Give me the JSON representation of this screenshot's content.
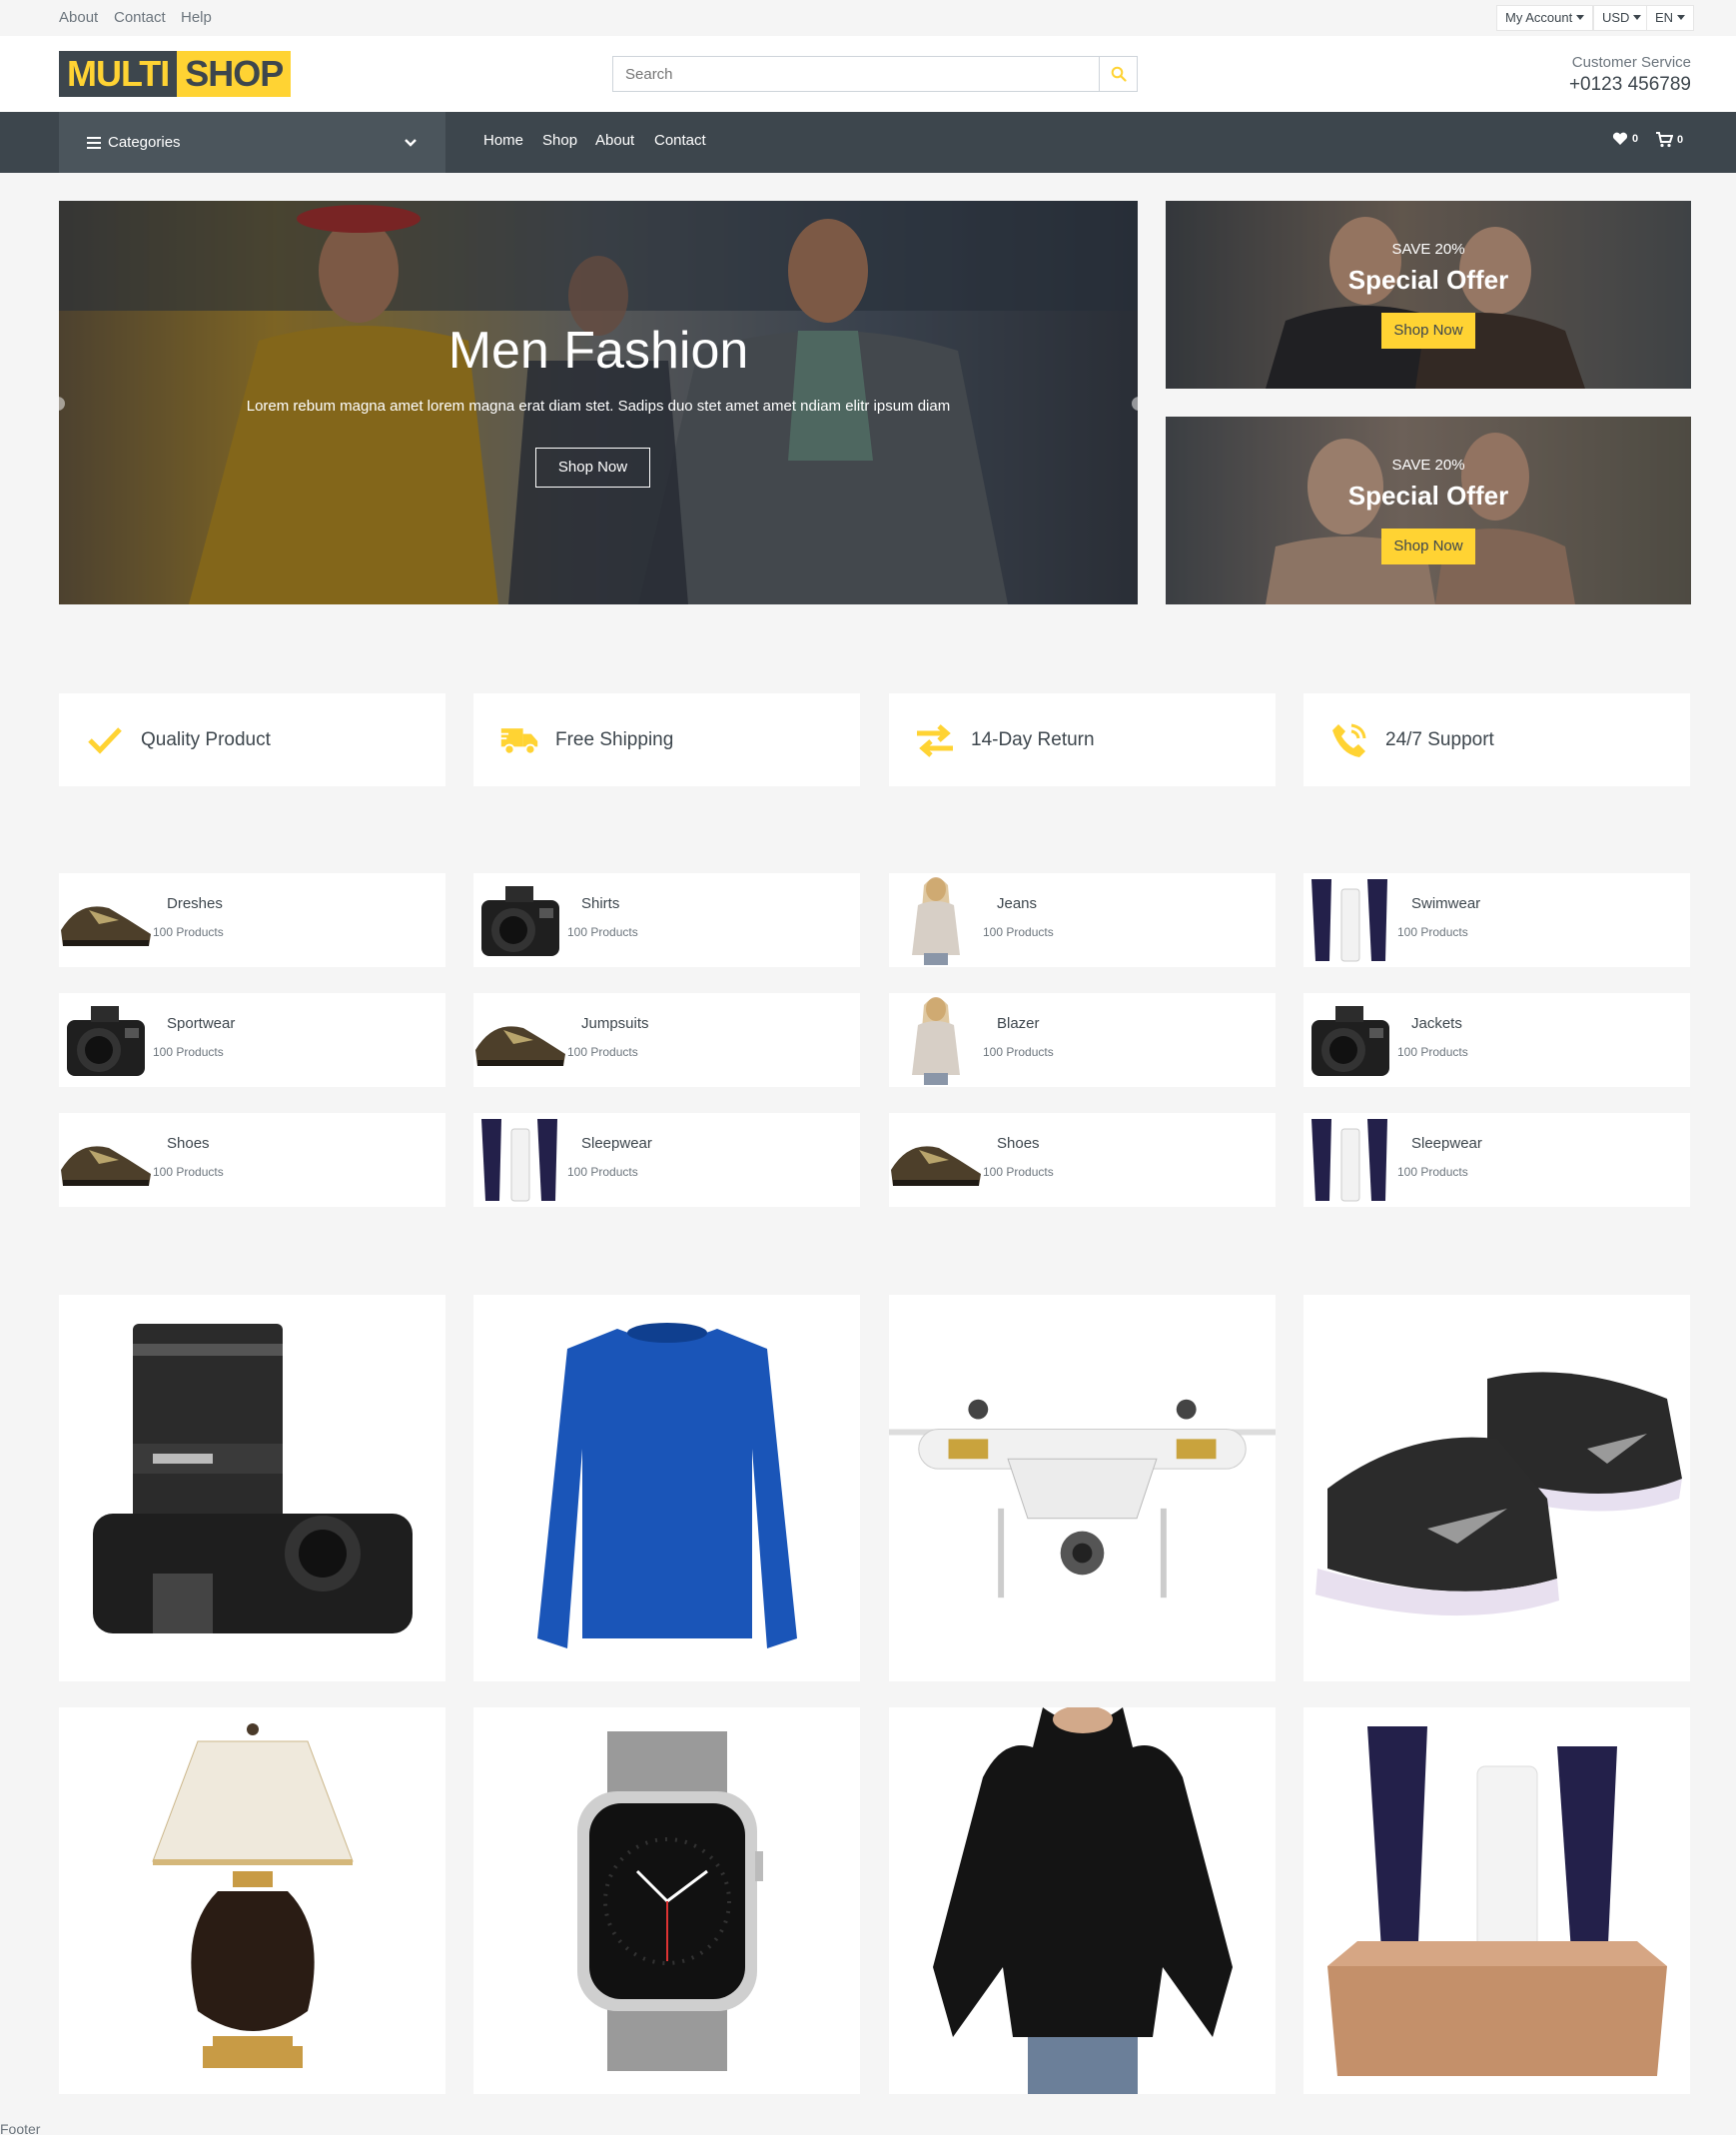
{
  "topbar": {
    "links": [
      "About",
      "Contact",
      "Help"
    ],
    "account_label": "My Account",
    "currency_label": "USD",
    "language_label": "EN"
  },
  "header": {
    "logo_part1": "MULTI",
    "logo_part2": "SHOP",
    "search_placeholder": "Search",
    "service_label": "Customer Service",
    "service_phone": "+0123 456789"
  },
  "navbar": {
    "categories_label": "Categories",
    "links": [
      "Home",
      "Shop",
      "About",
      "Contact"
    ],
    "wishlist_count": "0",
    "cart_count": "0"
  },
  "hero": {
    "title": "Men Fashion",
    "text": "Lorem rebum magna amet lorem magna erat diam stet. Sadips duo stet amet amet ndiam elitr ipsum diam",
    "button_label": "Shop Now"
  },
  "offers": [
    {
      "save": "SAVE 20%",
      "title": "Special Offer",
      "button_label": "Shop Now"
    },
    {
      "save": "SAVE 20%",
      "title": "Special Offer",
      "button_label": "Shop Now"
    }
  ],
  "features": [
    {
      "label": "Quality Product",
      "icon": "check-icon"
    },
    {
      "label": "Free Shipping",
      "icon": "shipping-icon"
    },
    {
      "label": "14-Day Return",
      "icon": "exchange-icon"
    },
    {
      "label": "24/7 Support",
      "icon": "phone-icon"
    }
  ],
  "categories": [
    {
      "name": "Dreshes",
      "count": "100 Products",
      "icon": "shoe-icon"
    },
    {
      "name": "Shirts",
      "count": "100 Products",
      "icon": "camera-icon"
    },
    {
      "name": "Jeans",
      "count": "100 Products",
      "icon": "woman-icon"
    },
    {
      "name": "Swimwear",
      "count": "100 Products",
      "icon": "cosmetics-icon"
    },
    {
      "name": "Sportwear",
      "count": "100 Products",
      "icon": "camera-icon"
    },
    {
      "name": "Jumpsuits",
      "count": "100 Products",
      "icon": "shoe-icon"
    },
    {
      "name": "Blazer",
      "count": "100 Products",
      "icon": "woman-icon"
    },
    {
      "name": "Jackets",
      "count": "100 Products",
      "icon": "camera-icon"
    },
    {
      "name": "Shoes",
      "count": "100 Products",
      "icon": "shoe-icon"
    },
    {
      "name": "Sleepwear",
      "count": "100 Products",
      "icon": "cosmetics-icon"
    },
    {
      "name": "Shoes",
      "count": "100 Products",
      "icon": "shoe-icon"
    },
    {
      "name": "Sleepwear",
      "count": "100 Products",
      "icon": "cosmetics-icon"
    }
  ],
  "products": [
    {
      "image": "camera-image"
    },
    {
      "image": "sweater-image"
    },
    {
      "image": "drone-image"
    },
    {
      "image": "sneakers-image"
    },
    {
      "image": "lamp-image"
    },
    {
      "image": "watch-image"
    },
    {
      "image": "blouse-image"
    },
    {
      "image": "cosmetics-image"
    }
  ],
  "footer": {
    "label": "Footer"
  },
  "colors": {
    "accent": "#ffd333",
    "dark": "#3d464d",
    "muted": "#6c757d",
    "background": "#f5f5f5"
  }
}
